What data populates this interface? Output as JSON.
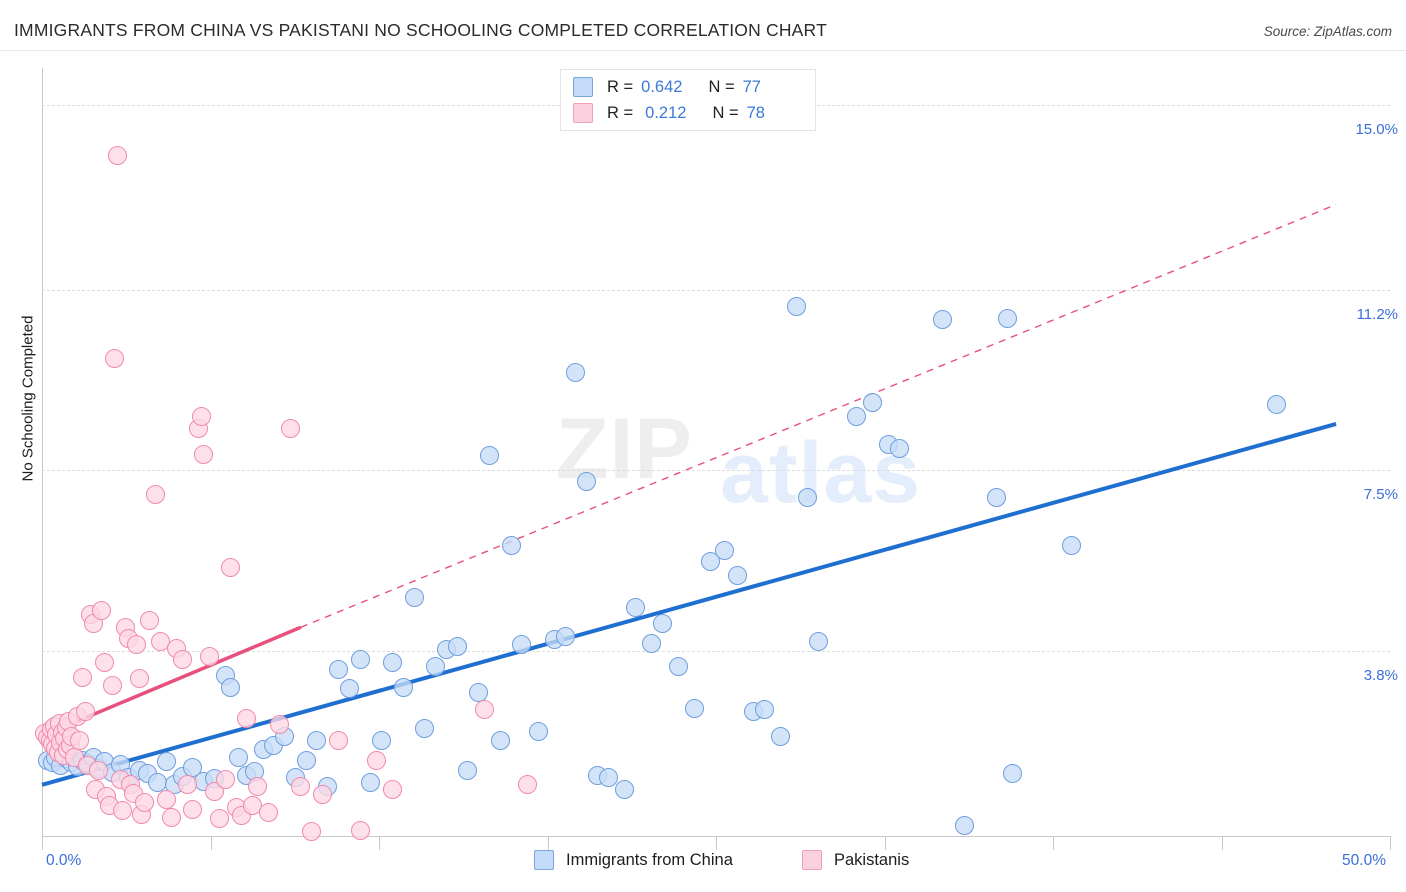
{
  "header": {
    "title": "IMMIGRANTS FROM CHINA VS PAKISTANI NO SCHOOLING COMPLETED CORRELATION CHART",
    "source": "Source: ZipAtlas.com"
  },
  "watermark": {
    "part1": "ZIP",
    "part2": "atlas"
  },
  "stats_legend": {
    "rows": [
      {
        "series": "Immigrants from China",
        "r_label": "R =",
        "r_value": "0.642",
        "n_label": "N =",
        "n_value": "77",
        "color": "#c3dbf7"
      },
      {
        "series": "Pakistanis",
        "r_label": "R =",
        "r_value": "0.212",
        "n_label": "N =",
        "n_value": "78",
        "color": "#fbd0df"
      }
    ]
  },
  "bottom_legend": [
    {
      "label": "Immigrants from China",
      "color": "#c3dbf7"
    },
    {
      "label": "Pakistanis",
      "color": "#fbd0df"
    }
  ],
  "chart_data": {
    "type": "scatter",
    "title": "IMMIGRANTS FROM CHINA VS PAKISTANI NO SCHOOLING COMPLETED CORRELATION CHART",
    "xlabel": "",
    "ylabel": "No Schooling Completed",
    "xlim": [
      0.0,
      50.0
    ],
    "ylim": [
      0.0,
      15.75
    ],
    "xtick_labels": [
      "0.0%",
      "50.0%"
    ],
    "ytick_labels": [
      "3.8%",
      "7.5%",
      "11.2%",
      "15.0%"
    ],
    "ytick_values": [
      3.8,
      7.5,
      11.2,
      15.0
    ],
    "grid": true,
    "legend_position": "bottom",
    "series": [
      {
        "name": "Immigrants from China",
        "color": "#c3dbf7",
        "edge_color": "#6f9ede",
        "r": 0.642,
        "n": 77,
        "trendline": {
          "style": "solid",
          "color": "#1f6fd0",
          "x0": 0.0,
          "y0": 1.05,
          "x1": 48.0,
          "y1": 8.45
        },
        "points": [
          [
            0.2,
            1.55
          ],
          [
            0.4,
            1.5
          ],
          [
            0.5,
            1.62
          ],
          [
            0.7,
            1.45
          ],
          [
            0.9,
            1.58
          ],
          [
            1.1,
            1.5
          ],
          [
            1.3,
            1.42
          ],
          [
            1.5,
            1.55
          ],
          [
            1.7,
            1.48
          ],
          [
            1.9,
            1.6
          ],
          [
            2.1,
            1.38
          ],
          [
            2.3,
            1.52
          ],
          [
            2.6,
            1.3
          ],
          [
            2.9,
            1.46
          ],
          [
            3.2,
            1.2
          ],
          [
            3.6,
            1.35
          ],
          [
            3.9,
            1.28
          ],
          [
            4.3,
            1.1
          ],
          [
            4.6,
            1.52
          ],
          [
            4.9,
            1.05
          ],
          [
            5.2,
            1.22
          ],
          [
            5.6,
            1.4
          ],
          [
            6.0,
            1.12
          ],
          [
            6.4,
            1.18
          ],
          [
            6.8,
            3.3
          ],
          [
            7.0,
            3.05
          ],
          [
            7.3,
            1.6
          ],
          [
            7.6,
            1.25
          ],
          [
            7.9,
            1.32
          ],
          [
            8.2,
            1.78
          ],
          [
            8.6,
            1.85
          ],
          [
            9.0,
            2.05
          ],
          [
            9.4,
            1.2
          ],
          [
            9.8,
            1.55
          ],
          [
            10.2,
            1.95
          ],
          [
            10.6,
            1.02
          ],
          [
            11.0,
            3.42
          ],
          [
            11.4,
            3.02
          ],
          [
            11.8,
            3.62
          ],
          [
            12.2,
            1.1
          ],
          [
            12.6,
            1.95
          ],
          [
            13.0,
            3.55
          ],
          [
            13.4,
            3.05
          ],
          [
            13.8,
            4.9
          ],
          [
            14.2,
            2.2
          ],
          [
            14.6,
            3.48
          ],
          [
            15.0,
            3.82
          ],
          [
            15.4,
            3.88
          ],
          [
            15.8,
            1.35
          ],
          [
            16.2,
            2.95
          ],
          [
            16.6,
            7.8
          ],
          [
            17.0,
            1.95
          ],
          [
            17.4,
            5.95
          ],
          [
            17.8,
            3.92
          ],
          [
            18.4,
            2.15
          ],
          [
            19.0,
            4.02
          ],
          [
            19.4,
            4.1
          ],
          [
            19.8,
            9.5
          ],
          [
            20.2,
            7.28
          ],
          [
            20.6,
            1.25
          ],
          [
            21.0,
            1.2
          ],
          [
            21.6,
            0.95
          ],
          [
            22.0,
            4.68
          ],
          [
            22.6,
            3.95
          ],
          [
            23.0,
            4.35
          ],
          [
            23.6,
            3.48
          ],
          [
            24.2,
            2.62
          ],
          [
            24.8,
            5.62
          ],
          [
            25.3,
            5.85
          ],
          [
            25.8,
            5.35
          ],
          [
            26.4,
            2.55
          ],
          [
            26.8,
            2.6
          ],
          [
            27.4,
            2.05
          ],
          [
            28.0,
            10.85
          ],
          [
            28.4,
            6.95
          ],
          [
            28.8,
            3.98
          ],
          [
            30.2,
            8.6
          ],
          [
            30.8,
            8.9
          ],
          [
            31.4,
            8.02
          ],
          [
            31.8,
            7.95
          ],
          [
            33.4,
            10.6
          ],
          [
            34.2,
            0.22
          ],
          [
            35.8,
            10.62
          ],
          [
            35.4,
            6.95
          ],
          [
            36.0,
            1.28
          ],
          [
            38.2,
            5.95
          ],
          [
            45.8,
            8.85
          ]
        ]
      },
      {
        "name": "Pakistanis",
        "color": "#fbd0df",
        "edge_color": "#f08aad",
        "r": 0.212,
        "n": 78,
        "trendline": {
          "style": "solid-then-dashed",
          "color": "#e8517d",
          "x0": 0.0,
          "y0": 2.05,
          "x1": 9.6,
          "y1": 4.28,
          "x_dash_end": 48.0,
          "y_dash_end": 12.95
        },
        "points": [
          [
            0.1,
            2.1
          ],
          [
            0.2,
            2.02
          ],
          [
            0.3,
            1.95
          ],
          [
            0.35,
            2.18
          ],
          [
            0.4,
            1.88
          ],
          [
            0.45,
            2.25
          ],
          [
            0.5,
            1.8
          ],
          [
            0.55,
            2.08
          ],
          [
            0.6,
            1.72
          ],
          [
            0.65,
            2.3
          ],
          [
            0.7,
            1.92
          ],
          [
            0.75,
            2.12
          ],
          [
            0.8,
            1.65
          ],
          [
            0.85,
            2.0
          ],
          [
            0.9,
            2.22
          ],
          [
            0.95,
            1.78
          ],
          [
            1.0,
            2.35
          ],
          [
            1.05,
            1.85
          ],
          [
            1.1,
            2.05
          ],
          [
            1.2,
            1.6
          ],
          [
            1.3,
            2.45
          ],
          [
            1.4,
            1.95
          ],
          [
            1.5,
            3.25
          ],
          [
            1.6,
            2.55
          ],
          [
            1.7,
            1.45
          ],
          [
            1.8,
            4.55
          ],
          [
            1.9,
            4.35
          ],
          [
            2.0,
            0.95
          ],
          [
            2.1,
            1.35
          ],
          [
            2.2,
            4.62
          ],
          [
            2.3,
            3.55
          ],
          [
            2.4,
            0.8
          ],
          [
            2.5,
            0.62
          ],
          [
            2.6,
            3.08
          ],
          [
            2.7,
            9.8
          ],
          [
            2.8,
            13.95
          ],
          [
            2.9,
            1.15
          ],
          [
            3.0,
            0.52
          ],
          [
            3.1,
            4.28
          ],
          [
            3.2,
            4.05
          ],
          [
            3.3,
            1.05
          ],
          [
            3.4,
            0.88
          ],
          [
            3.5,
            3.92
          ],
          [
            3.6,
            3.22
          ],
          [
            3.7,
            0.45
          ],
          [
            3.8,
            0.68
          ],
          [
            4.0,
            4.42
          ],
          [
            4.2,
            7.0
          ],
          [
            4.4,
            3.98
          ],
          [
            4.6,
            0.75
          ],
          [
            4.8,
            0.38
          ],
          [
            5.0,
            3.85
          ],
          [
            5.2,
            3.62
          ],
          [
            5.4,
            1.05
          ],
          [
            5.6,
            0.55
          ],
          [
            5.8,
            8.35
          ],
          [
            5.9,
            8.6
          ],
          [
            6.0,
            7.82
          ],
          [
            6.2,
            3.68
          ],
          [
            6.4,
            0.92
          ],
          [
            6.6,
            0.35
          ],
          [
            6.8,
            1.15
          ],
          [
            7.0,
            5.5
          ],
          [
            7.2,
            0.58
          ],
          [
            7.4,
            0.42
          ],
          [
            7.6,
            2.4
          ],
          [
            7.8,
            0.62
          ],
          [
            8.0,
            1.02
          ],
          [
            8.4,
            0.48
          ],
          [
            8.8,
            2.28
          ],
          [
            9.2,
            8.35
          ],
          [
            9.6,
            1.02
          ],
          [
            10.0,
            0.1
          ],
          [
            10.4,
            0.85
          ],
          [
            11.0,
            1.95
          ],
          [
            11.8,
            0.12
          ],
          [
            12.4,
            1.55
          ],
          [
            13.0,
            0.95
          ],
          [
            16.4,
            2.6
          ],
          [
            18.0,
            1.05
          ]
        ]
      }
    ]
  }
}
